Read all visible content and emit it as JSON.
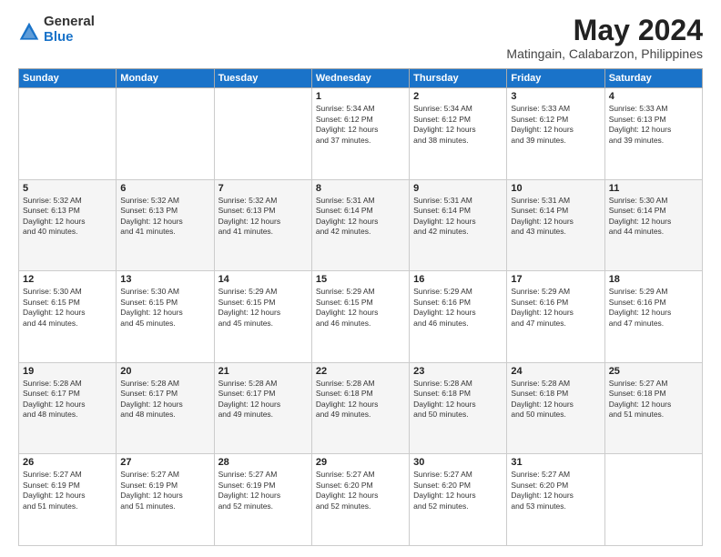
{
  "logo": {
    "general": "General",
    "blue": "Blue"
  },
  "title": "May 2024",
  "location": "Matingain, Calabarzon, Philippines",
  "weekdays": [
    "Sunday",
    "Monday",
    "Tuesday",
    "Wednesday",
    "Thursday",
    "Friday",
    "Saturday"
  ],
  "weeks": [
    [
      {
        "day": "",
        "info": ""
      },
      {
        "day": "",
        "info": ""
      },
      {
        "day": "",
        "info": ""
      },
      {
        "day": "1",
        "info": "Sunrise: 5:34 AM\nSunset: 6:12 PM\nDaylight: 12 hours\nand 37 minutes."
      },
      {
        "day": "2",
        "info": "Sunrise: 5:34 AM\nSunset: 6:12 PM\nDaylight: 12 hours\nand 38 minutes."
      },
      {
        "day": "3",
        "info": "Sunrise: 5:33 AM\nSunset: 6:12 PM\nDaylight: 12 hours\nand 39 minutes."
      },
      {
        "day": "4",
        "info": "Sunrise: 5:33 AM\nSunset: 6:13 PM\nDaylight: 12 hours\nand 39 minutes."
      }
    ],
    [
      {
        "day": "5",
        "info": "Sunrise: 5:32 AM\nSunset: 6:13 PM\nDaylight: 12 hours\nand 40 minutes."
      },
      {
        "day": "6",
        "info": "Sunrise: 5:32 AM\nSunset: 6:13 PM\nDaylight: 12 hours\nand 41 minutes."
      },
      {
        "day": "7",
        "info": "Sunrise: 5:32 AM\nSunset: 6:13 PM\nDaylight: 12 hours\nand 41 minutes."
      },
      {
        "day": "8",
        "info": "Sunrise: 5:31 AM\nSunset: 6:14 PM\nDaylight: 12 hours\nand 42 minutes."
      },
      {
        "day": "9",
        "info": "Sunrise: 5:31 AM\nSunset: 6:14 PM\nDaylight: 12 hours\nand 42 minutes."
      },
      {
        "day": "10",
        "info": "Sunrise: 5:31 AM\nSunset: 6:14 PM\nDaylight: 12 hours\nand 43 minutes."
      },
      {
        "day": "11",
        "info": "Sunrise: 5:30 AM\nSunset: 6:14 PM\nDaylight: 12 hours\nand 44 minutes."
      }
    ],
    [
      {
        "day": "12",
        "info": "Sunrise: 5:30 AM\nSunset: 6:15 PM\nDaylight: 12 hours\nand 44 minutes."
      },
      {
        "day": "13",
        "info": "Sunrise: 5:30 AM\nSunset: 6:15 PM\nDaylight: 12 hours\nand 45 minutes."
      },
      {
        "day": "14",
        "info": "Sunrise: 5:29 AM\nSunset: 6:15 PM\nDaylight: 12 hours\nand 45 minutes."
      },
      {
        "day": "15",
        "info": "Sunrise: 5:29 AM\nSunset: 6:15 PM\nDaylight: 12 hours\nand 46 minutes."
      },
      {
        "day": "16",
        "info": "Sunrise: 5:29 AM\nSunset: 6:16 PM\nDaylight: 12 hours\nand 46 minutes."
      },
      {
        "day": "17",
        "info": "Sunrise: 5:29 AM\nSunset: 6:16 PM\nDaylight: 12 hours\nand 47 minutes."
      },
      {
        "day": "18",
        "info": "Sunrise: 5:29 AM\nSunset: 6:16 PM\nDaylight: 12 hours\nand 47 minutes."
      }
    ],
    [
      {
        "day": "19",
        "info": "Sunrise: 5:28 AM\nSunset: 6:17 PM\nDaylight: 12 hours\nand 48 minutes."
      },
      {
        "day": "20",
        "info": "Sunrise: 5:28 AM\nSunset: 6:17 PM\nDaylight: 12 hours\nand 48 minutes."
      },
      {
        "day": "21",
        "info": "Sunrise: 5:28 AM\nSunset: 6:17 PM\nDaylight: 12 hours\nand 49 minutes."
      },
      {
        "day": "22",
        "info": "Sunrise: 5:28 AM\nSunset: 6:18 PM\nDaylight: 12 hours\nand 49 minutes."
      },
      {
        "day": "23",
        "info": "Sunrise: 5:28 AM\nSunset: 6:18 PM\nDaylight: 12 hours\nand 50 minutes."
      },
      {
        "day": "24",
        "info": "Sunrise: 5:28 AM\nSunset: 6:18 PM\nDaylight: 12 hours\nand 50 minutes."
      },
      {
        "day": "25",
        "info": "Sunrise: 5:27 AM\nSunset: 6:18 PM\nDaylight: 12 hours\nand 51 minutes."
      }
    ],
    [
      {
        "day": "26",
        "info": "Sunrise: 5:27 AM\nSunset: 6:19 PM\nDaylight: 12 hours\nand 51 minutes."
      },
      {
        "day": "27",
        "info": "Sunrise: 5:27 AM\nSunset: 6:19 PM\nDaylight: 12 hours\nand 51 minutes."
      },
      {
        "day": "28",
        "info": "Sunrise: 5:27 AM\nSunset: 6:19 PM\nDaylight: 12 hours\nand 52 minutes."
      },
      {
        "day": "29",
        "info": "Sunrise: 5:27 AM\nSunset: 6:20 PM\nDaylight: 12 hours\nand 52 minutes."
      },
      {
        "day": "30",
        "info": "Sunrise: 5:27 AM\nSunset: 6:20 PM\nDaylight: 12 hours\nand 52 minutes."
      },
      {
        "day": "31",
        "info": "Sunrise: 5:27 AM\nSunset: 6:20 PM\nDaylight: 12 hours\nand 53 minutes."
      },
      {
        "day": "",
        "info": ""
      }
    ]
  ]
}
